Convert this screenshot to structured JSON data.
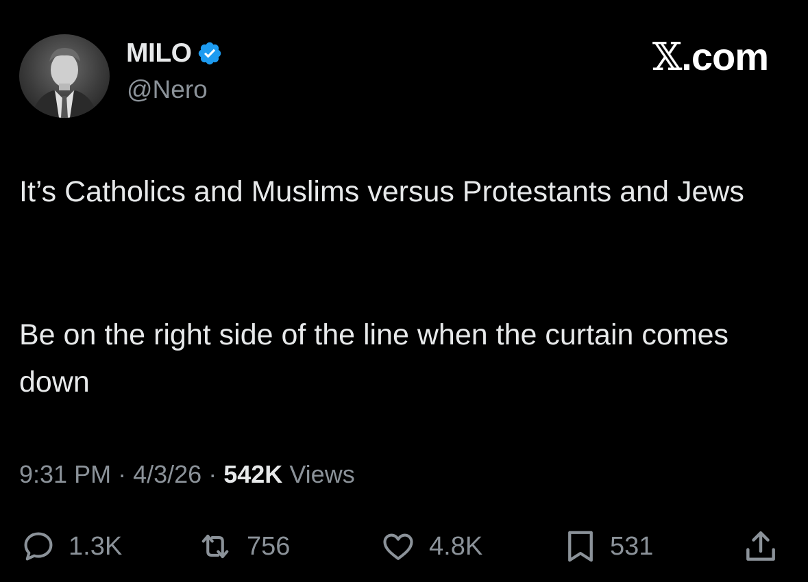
{
  "author": {
    "display_name": "MILO",
    "handle": "@Nero",
    "verified": true,
    "verified_color": "#1d9bf0"
  },
  "brand": {
    "mark": "𝕏",
    "domain": ".com"
  },
  "tweet": {
    "paragraphs": [
      "It’s Catholics and Muslims versus Protestants and Jews",
      "Be on the right side of the line when the curtain comes down"
    ]
  },
  "meta": {
    "time": "9:31 PM",
    "separator": "·",
    "date": "4/3/26",
    "views_count": "542K",
    "views_label": "Views"
  },
  "actions": {
    "replies": "1.3K",
    "reposts": "756",
    "likes": "4.8K",
    "bookmarks": "531"
  },
  "icons": {
    "reply": "reply-icon",
    "repost": "repost-icon",
    "like": "heart-icon",
    "bookmark": "bookmark-icon",
    "share": "share-icon",
    "verified": "verified-badge-icon"
  },
  "colors": {
    "background": "#000000",
    "text": "#e7e9ea",
    "secondary": "#8b9299"
  }
}
